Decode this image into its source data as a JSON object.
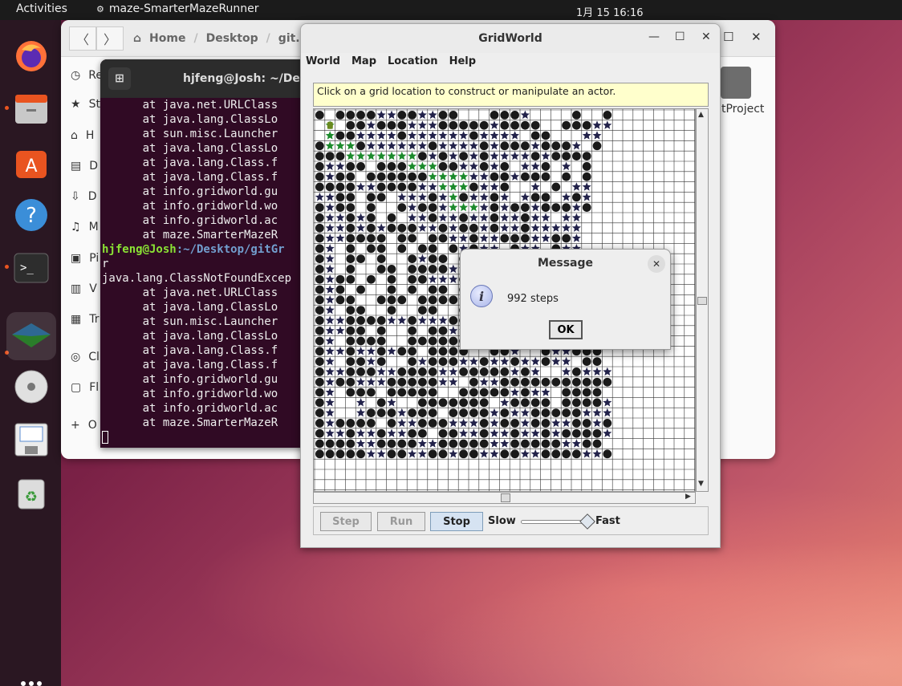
{
  "topbar": {
    "activities": "Activities",
    "app_name": "maze-SmarterMazeRunner",
    "clock": "1月 15 16:16"
  },
  "files": {
    "path": [
      "Home",
      "Desktop",
      "git..."
    ],
    "sidebar": [
      "Re",
      "St",
      "H",
      "D",
      "D",
      "M",
      "Pi",
      "V",
      "Tr",
      "Cl",
      "Fl",
      "O"
    ],
    "folder_label": "tProject"
  },
  "terminal": {
    "title": "hjfeng@Josh: ~/Desk",
    "lines_top": [
      "      at java.net.URLClass",
      "      at java.lang.ClassLo",
      "      at sun.misc.Launcher",
      "      at java.lang.ClassLo",
      "      at java.lang.Class.f",
      "      at java.lang.Class.f",
      "      at info.gridworld.gu",
      "      at info.gridworld.wo",
      "      at info.gridworld.ac",
      "      at maze.SmarterMazeR"
    ],
    "prompt_user": "hjfeng@Josh",
    "prompt_path": ":~/Desktop/gitGr",
    "line_r": "r",
    "exception": "java.lang.ClassNotFoundExcep",
    "lines_bottom": [
      "      at java.net.URLClass",
      "      at java.lang.ClassLo",
      "      at sun.misc.Launcher",
      "      at java.lang.ClassLo",
      "      at java.lang.Class.f",
      "      at java.lang.Class.f",
      "      at info.gridworld.gu",
      "      at info.gridworld.wo",
      "      at info.gridworld.ac",
      "      at maze.SmarterMazeR"
    ]
  },
  "gridworld": {
    "title": "GridWorld",
    "menu": [
      "World",
      "Map",
      "Location",
      "Help"
    ],
    "message": "Click on a grid location to construct or manipulate an actor.",
    "buttons": {
      "step": "Step",
      "run": "Run",
      "stop": "Stop"
    },
    "slow": "Slow",
    "fast": "Fast",
    "speed_fraction": 0.9,
    "maze_rows": [
      "R.RRRRFFRRFFRR...RRRF....R..R",
      ".G.RRFRRRFFFRRRRRFRRRR..RRRFF",
      ".GRRFFFFRFFFFFFRFFFF.RR...FF",
      "RGGGRFFFFFFRFFFFRFRRRFRRRF.R",
      "RRRGGGGGGGRFRFRFRFFFFRFRRRR",
      "RFFRR.RRRGGGRRFFRFR.FFR.F.R",
      "RFRR.RRRRRRGGGGFFRRFRRR.R.R",
      "RRRRFFRRRRFFGGGRFFR..F.R.FF",
      "FFRR.RR.FFFRFGRFFRF.FRR.FRF",
      "RFRR.R..RFRRFGGGFRFRRFRRRFR",
      "RFFRFR.R.FFRFFRFFRFFRFF.FF",
      "RFFRFRFRRRFFRFRRFRFFRFFFFF",
      "RFFRRRR.RR.RRFFRFFRRRFFRRF",
      "RF.R.RR.R.RR.RFRFF.RFF.RFF",
      "RF.RR.R..RFRR.RFF.RRF.RRFR",
      "RF.R..RR.RRRRFFFFF.RF.RF",
      "RFRR.R.R.RRFFFRFFFFFRFFR",
      "RFR.R..R.R.RR.RFRF.R.FRRF",
      "RFRR..RRR.RRRRFRFFR.RRF",
      "RF.RR..R..RR..RRRRRRRRRRRR",
      "RFFRRRRFFRFFFRRRRRRRRFRRRRRR",
      "RFFRR.R..R.RRFFFFR.RRFRRFFRR",
      "RF.RRRR..RRRRRRRRRR.RRRRRRFF",
      "RFFRFFRFRR.RRRR..RRF..RFFRRR",
      "RF.RRFR..RFRRRFFRFFRFFRFF.RR",
      "RFFRRRFFRRRRFFRRRRRFRF..FRFFF",
      "RFRRFFFRRRRRFF.RFFRRRRRRRRRRR",
      "RF.RRR.RRRRR..RRRRRFRFF.RRRR",
      "RF..F.RF..RRRRRRR.FRRRR.RRRRF",
      "RF..FRRRFRRR.RRRRFRFFRRRRRFFF",
      "RFRRRR.RFFRRRFFFRFRRFRRFFRRFR",
      "RFFRFFRFFRR.RRFFRFFRFFRFRRRRF",
      "RRRRFFRRRRFFRRRRRFFRRRRRFFRR",
      "RRRRRFFRRFFRRFRRFFRRFFRRRRFFR"
    ]
  },
  "dialog": {
    "title": "Message",
    "text": "992 steps",
    "ok": "OK"
  }
}
